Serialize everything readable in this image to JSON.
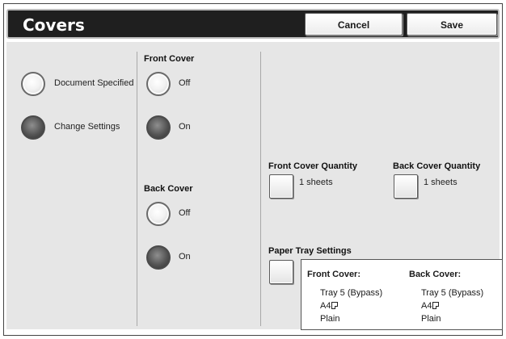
{
  "header": {
    "title": "Covers",
    "cancel_label": "Cancel",
    "save_label": "Save"
  },
  "mode": {
    "options": [
      {
        "label": "Document Specified",
        "selected": false
      },
      {
        "label": "Change Settings",
        "selected": true
      }
    ]
  },
  "front_cover": {
    "heading": "Front Cover",
    "off_label": "Off",
    "on_label": "On",
    "selected": "On"
  },
  "back_cover": {
    "heading": "Back Cover",
    "off_label": "Off",
    "on_label": "On",
    "selected": "On"
  },
  "front_qty": {
    "label": "Front Cover Quantity",
    "value": "1 sheets"
  },
  "back_qty": {
    "label": "Back Cover Quantity",
    "value": "1 sheets"
  },
  "tray": {
    "label": "Paper Tray Settings",
    "front": {
      "heading": "Front Cover:",
      "tray": "Tray 5 (Bypass)",
      "size": "A4",
      "type": "Plain"
    },
    "back": {
      "heading": "Back Cover:",
      "tray": "Tray 5 (Bypass)",
      "size": "A4",
      "type": "Plain"
    }
  },
  "colors": {
    "title_bar": "#1f1f1f",
    "content_bg": "#e6e6e6",
    "radio_selected": "#555555"
  }
}
